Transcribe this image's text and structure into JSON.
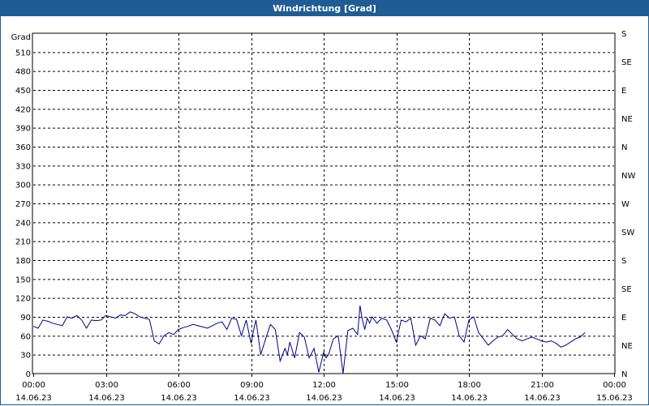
{
  "window": {
    "title": "Windrichtung [Grad]"
  },
  "colors": {
    "titlebar": "#1f5c96",
    "series": "#00008b",
    "grid": "#000000"
  },
  "chart_data": {
    "type": "line",
    "title": "Windrichtung [Grad]",
    "ylabel": "Grad",
    "ylim": [
      0,
      540
    ],
    "y_ticks": [
      0,
      30,
      60,
      90,
      120,
      150,
      180,
      210,
      240,
      270,
      300,
      330,
      360,
      390,
      420,
      450,
      480,
      510
    ],
    "right_axis_labels": [
      "N",
      "NE",
      "E",
      "SE",
      "S",
      "SW",
      "W",
      "NW",
      "N",
      "NE",
      "E",
      "SE",
      "S"
    ],
    "x_ticks": [
      {
        "time": "00:00",
        "date": "14.06.23"
      },
      {
        "time": "03:00",
        "date": "14.06.23"
      },
      {
        "time": "06:00",
        "date": "14.06.23"
      },
      {
        "time": "09:00",
        "date": "14.06.23"
      },
      {
        "time": "12:00",
        "date": "14.06.23"
      },
      {
        "time": "15:00",
        "date": "14.06.23"
      },
      {
        "time": "18:00",
        "date": "14.06.23"
      },
      {
        "time": "21:00",
        "date": "14.06.23"
      },
      {
        "time": "00:00",
        "date": "15.06.23"
      }
    ],
    "xlim_hours": [
      0,
      24
    ],
    "grid": true,
    "series": [
      {
        "hours": [
          0.0,
          0.2,
          0.4,
          0.5,
          0.6,
          0.8,
          1.0,
          1.2,
          1.4,
          1.6,
          1.8,
          2.0,
          2.2,
          2.4,
          2.6,
          2.8,
          3.0,
          3.2,
          3.4,
          3.6,
          3.8,
          4.0,
          4.2,
          4.4,
          4.6,
          4.8,
          5.0,
          5.2,
          5.4,
          5.6,
          5.8,
          6.0,
          6.2,
          6.4,
          6.6,
          6.8,
          7.0,
          7.2,
          7.4,
          7.6,
          7.8,
          8.0,
          8.2,
          8.4,
          8.6,
          8.8,
          9.0,
          9.1,
          9.2,
          9.4,
          9.6,
          9.8,
          10.0,
          10.2,
          10.4,
          10.5,
          10.6,
          10.8,
          11.0,
          11.2,
          11.4,
          11.6,
          11.8,
          12.0,
          12.1,
          12.2,
          12.4,
          12.6,
          12.8,
          13.0,
          13.2,
          13.4,
          13.5,
          13.6,
          13.7,
          13.8,
          13.9,
          14.0,
          14.2,
          14.4,
          14.6,
          14.8,
          15.0,
          15.2,
          15.4,
          15.6,
          15.8,
          16.0,
          16.2,
          16.4,
          16.6,
          16.8,
          17.0,
          17.2,
          17.4,
          17.6,
          17.8,
          18.0,
          18.2,
          18.4,
          18.6,
          18.8,
          19.0,
          19.2,
          19.4,
          19.6,
          19.8,
          20.0,
          20.2,
          20.4,
          20.6,
          20.8,
          21.0,
          21.2,
          21.4,
          21.6,
          21.8,
          22.0,
          22.2,
          22.4,
          22.6,
          22.8,
          23.0,
          23.2,
          23.4,
          23.6,
          23.8,
          24.0
        ],
        "values": [
          75,
          72,
          85,
          84,
          83,
          80,
          78,
          76,
          90,
          88,
          92,
          85,
          72,
          85,
          84,
          85,
          92,
          90,
          88,
          93,
          92,
          98,
          95,
          90,
          88,
          86,
          52,
          47,
          60,
          65,
          62,
          70,
          73,
          75,
          78,
          76,
          74,
          72,
          76,
          80,
          82,
          70,
          88,
          86,
          60,
          85,
          48,
          68,
          85,
          30,
          55,
          78,
          70,
          20,
          40,
          30,
          50,
          25,
          65,
          58,
          25,
          40,
          2,
          34,
          25,
          30,
          55,
          60,
          0,
          68,
          72,
          62,
          108,
          85,
          70,
          88,
          80,
          90,
          80,
          88,
          85,
          70,
          50,
          85,
          82,
          88,
          45,
          60,
          55,
          88,
          85,
          76,
          95,
          88,
          90,
          60,
          50,
          85,
          90,
          65,
          55,
          45,
          52,
          58,
          60,
          70,
          62,
          55,
          52,
          55,
          58,
          55,
          52,
          50,
          52,
          48,
          42,
          45,
          50,
          55,
          58,
          65
        ]
      }
    ]
  }
}
